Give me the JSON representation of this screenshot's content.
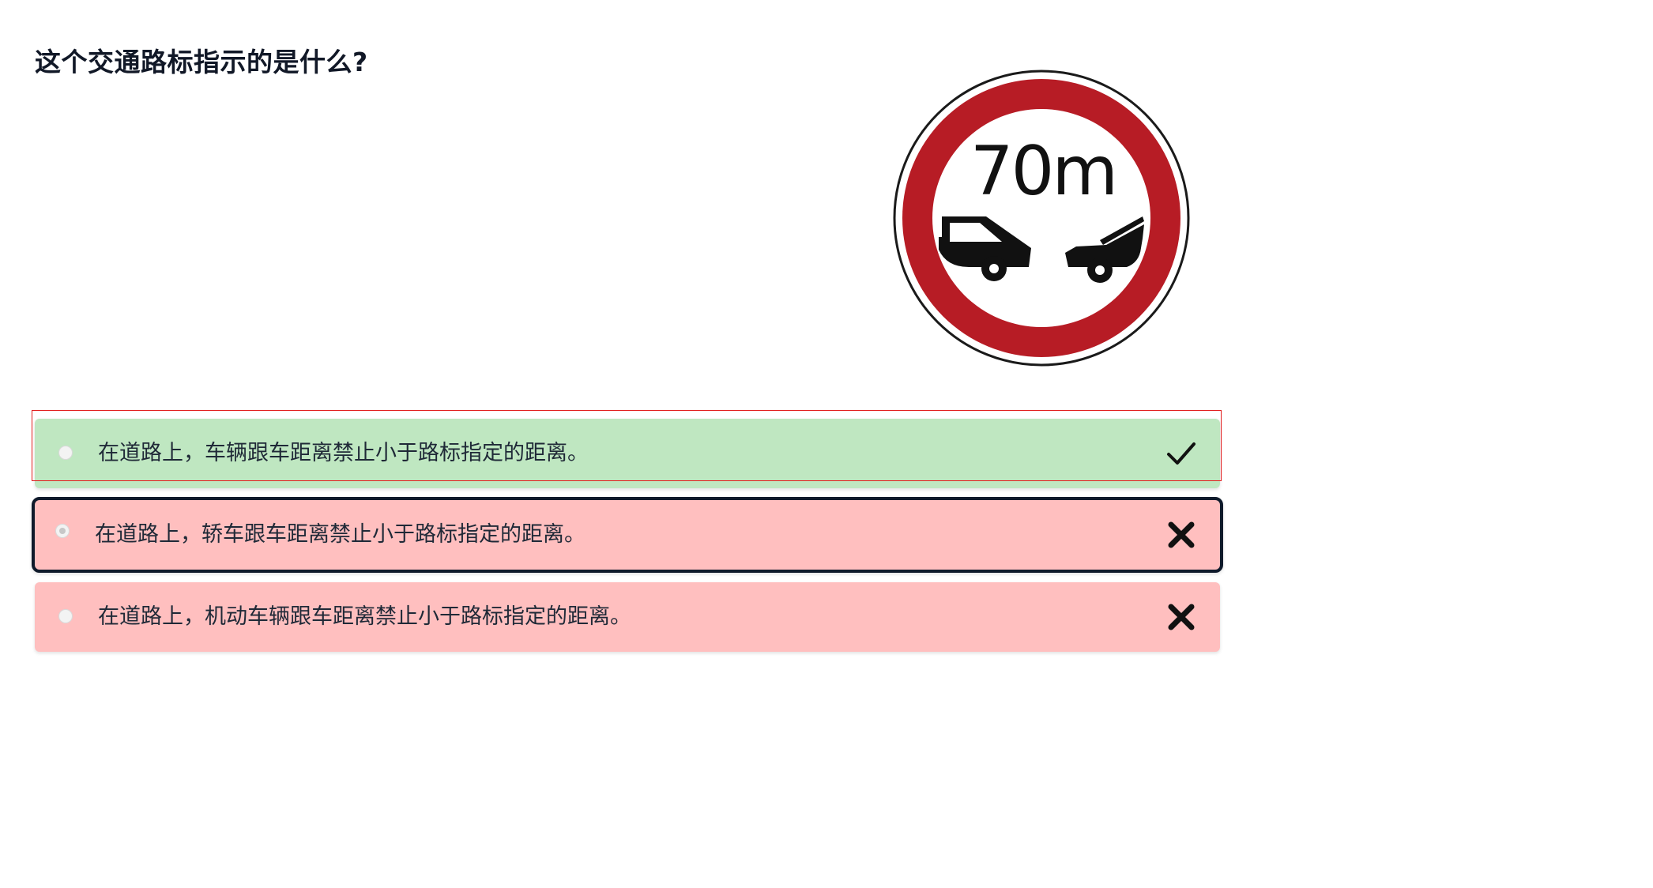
{
  "question": {
    "title": "这个交通路标指示的是什么?"
  },
  "sign": {
    "icon": "no-close-following-sign",
    "text": "70m",
    "ring_color": "#b71c25"
  },
  "answers": [
    {
      "label": "在道路上，车辆跟车距离禁止小于路标指定的距离。",
      "status": "correct",
      "status_icon": "checkmark-icon",
      "color": "#bfe7c1"
    },
    {
      "label": "在道路上，轿车跟车距离禁止小于路标指定的距离。",
      "status": "wrong",
      "selected": true,
      "status_icon": "cross-icon",
      "color": "#ffbfbf"
    },
    {
      "label": "在道路上，机动车辆跟车距离禁止小于路标指定的距离。",
      "status": "wrong",
      "status_icon": "cross-icon",
      "color": "#ffbfbf"
    }
  ]
}
